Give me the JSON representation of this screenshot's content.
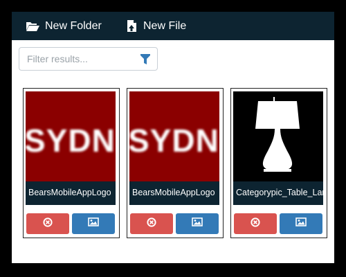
{
  "toolbar": {
    "new_folder_label": "New Folder",
    "new_folder_icon": "folder-open-icon",
    "new_file_label": "New File",
    "new_file_icon": "file-upload-icon",
    "background": "#0d2431"
  },
  "filter": {
    "placeholder": "Filter results...",
    "value": "",
    "icon": "funnel-icon"
  },
  "files": [
    {
      "name": "BearsMobileAppLogo",
      "thumbnail_text": "SYDN",
      "thumbnail_background": "#8b0000"
    },
    {
      "name": "BearsMobileAppLogo",
      "thumbnail_text": "SYDN",
      "thumbnail_background": "#8b0000"
    },
    {
      "name": "Categorypic_Table_Lamp",
      "thumbnail_image": "table-lamp",
      "thumbnail_background": "#000000"
    }
  ],
  "card_actions": {
    "delete_icon": "circle-x-icon",
    "delete_color": "#d9534f",
    "image_icon": "image-icon",
    "image_color": "#337ab7"
  }
}
